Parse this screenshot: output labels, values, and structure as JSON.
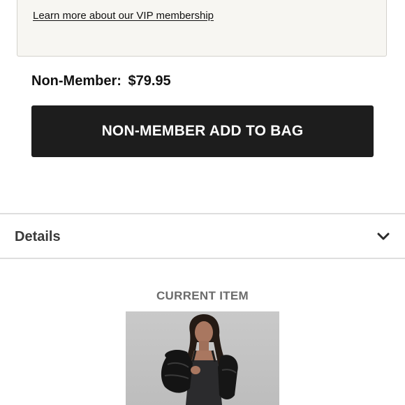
{
  "vip": {
    "link_text": "Learn more about our VIP membership"
  },
  "pricing": {
    "label": "Non-Member:",
    "amount": "$79.95"
  },
  "add_to_bag": {
    "label": "NON-MEMBER ADD TO BAG"
  },
  "details": {
    "label": "Details",
    "icon": "chevron-down-icon"
  },
  "current_item": {
    "heading": "CURRENT ITEM",
    "image_subject": "model-wearing-black-puffer-jacket"
  },
  "colors": {
    "button_bg": "#1d1d1d",
    "vip_box_bg": "#f7f6f2",
    "divider": "#dedede"
  }
}
